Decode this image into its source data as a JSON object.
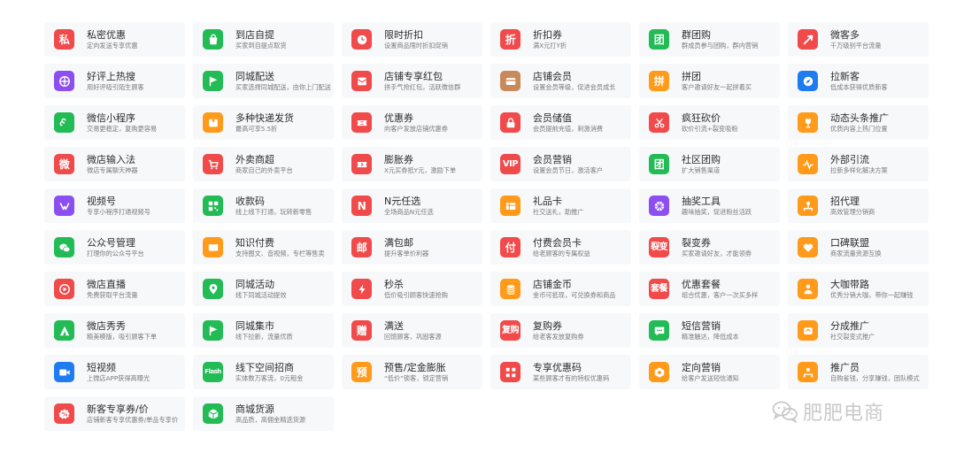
{
  "cards": [
    {
      "title": "私密优惠",
      "desc": "定向发送专享优惠",
      "icon": "private-icon",
      "glyph": "私",
      "color": "#f04a4a"
    },
    {
      "title": "到店自提",
      "desc": "买家到自提点取货",
      "icon": "bag-icon",
      "color": "#22bb55"
    },
    {
      "title": "限时折扣",
      "desc": "设置商品限时折扣促销",
      "icon": "clock-icon",
      "color": "#f04a4a"
    },
    {
      "title": "折扣券",
      "desc": "满X元打Y折",
      "icon": "discount-coupon-icon",
      "glyph": "折",
      "color": "#f04a4a"
    },
    {
      "title": "群团购",
      "desc": "群成员参与团购，群内营销",
      "icon": "group-buy-icon",
      "glyph": "团",
      "color": "#22bb55"
    },
    {
      "title": "微客多",
      "desc": "千万级别平台流量",
      "icon": "rocket-icon",
      "color": "#f04a4a"
    },
    {
      "title": "好评上热搜",
      "desc": "用好评吸引陌生顾客",
      "icon": "hot-search-icon",
      "color": "#8b4ef0"
    },
    {
      "title": "同城配送",
      "desc": "买家选择同城配送，由你上门配送服务",
      "icon": "flag-icon",
      "color": "#22bb55"
    },
    {
      "title": "店铺专享红包",
      "desc": "拼手气抢红包，活跃微信群",
      "icon": "red-packet-icon",
      "color": "#f04a4a"
    },
    {
      "title": "店铺会员",
      "desc": "设置会员等级，促进会员成长",
      "icon": "member-card-icon",
      "color": "#c9895a"
    },
    {
      "title": "拼团",
      "desc": "客户邀请好友一起拼着买",
      "icon": "pintuan-icon",
      "glyph": "拼",
      "color": "#ff9a1a"
    },
    {
      "title": "拉新客",
      "desc": "低成本获得优质新客",
      "icon": "compass-icon",
      "color": "#1f7cf0"
    },
    {
      "title": "微信小程序",
      "desc": "交易更稳定，复购更容易",
      "icon": "mini-program-icon",
      "color": "#22bb55"
    },
    {
      "title": "多种快递发货",
      "desc": "最高可享5.5折",
      "icon": "package-icon",
      "color": "#ff9a1a"
    },
    {
      "title": "优惠券",
      "desc": "向客户发放店铺优惠券",
      "icon": "ticket-icon",
      "color": "#f04a4a"
    },
    {
      "title": "会员储值",
      "desc": "会员提前充值，刺激消费",
      "icon": "lock-icon",
      "color": "#f04a4a"
    },
    {
      "title": "疯狂砍价",
      "desc": "砍价引流+裂变吸粉",
      "icon": "scissors-icon",
      "color": "#f04a4a"
    },
    {
      "title": "动态头条推广",
      "desc": "优质内容上热门位置",
      "icon": "trophy-icon",
      "color": "#ff9a1a"
    },
    {
      "title": "微店输入法",
      "desc": "微店专属聊天神器",
      "icon": "keyboard-icon",
      "glyph": "微",
      "color": "#f04a4a"
    },
    {
      "title": "外卖商超",
      "desc": "商家自己的外卖平台",
      "icon": "cart-icon",
      "color": "#f04a4a"
    },
    {
      "title": "膨胀券",
      "desc": "X元买券抵Y元，激励下单",
      "icon": "expand-coupon-icon",
      "color": "#f04a4a"
    },
    {
      "title": "会员营销",
      "desc": "设置会员节日，激活客户",
      "icon": "vip-icon",
      "glyph": "VIP",
      "color": "#f04a4a"
    },
    {
      "title": "社区团购",
      "desc": "扩大销售渠道",
      "icon": "community-icon",
      "glyph": "团",
      "color": "#22bb55"
    },
    {
      "title": "外部引流",
      "desc": "拉新多样化解决方案",
      "icon": "pulse-icon",
      "color": "#ff9a1a"
    },
    {
      "title": "视频号",
      "desc": "专享小程序打通视频号",
      "icon": "channels-icon",
      "color": "#8b4ef0"
    },
    {
      "title": "收款码",
      "desc": "线上线下打通，玩转新零售",
      "icon": "qr-icon",
      "color": "#22bb55"
    },
    {
      "title": "N元任选",
      "desc": "全场商品N元任选",
      "icon": "n-yuan-icon",
      "glyph": "N",
      "color": "#f04a4a"
    },
    {
      "title": "礼品卡",
      "desc": "社交送礼，助推广",
      "icon": "gift-card-icon",
      "color": "#ff9a1a"
    },
    {
      "title": "抽奖工具",
      "desc": "趣味抽奖，促进粉丝活跃",
      "icon": "lottery-icon",
      "color": "#8b4ef0"
    },
    {
      "title": "招代理",
      "desc": "高效管理分销商",
      "icon": "agent-icon",
      "color": "#ff9a1a"
    },
    {
      "title": "公众号管理",
      "desc": "打理你的公众号平台",
      "icon": "wechat-icon",
      "color": "#22bb55"
    },
    {
      "title": "知识付费",
      "desc": "支持图文、音视频，专栏等售卖",
      "icon": "book-icon",
      "color": "#ff9a1a"
    },
    {
      "title": "满包邮",
      "desc": "提升客单价利器",
      "icon": "free-shipping-icon",
      "glyph": "邮",
      "color": "#f04a4a"
    },
    {
      "title": "付费会员卡",
      "desc": "给老顾客的专属权益",
      "icon": "paid-card-icon",
      "glyph": "付",
      "color": "#f04a4a"
    },
    {
      "title": "裂变券",
      "desc": "买家邀请好友，才能领券",
      "icon": "fission-icon",
      "glyph": "裂变",
      "color": "#f04a4a"
    },
    {
      "title": "口碑联盟",
      "desc": "商家流量资源互换",
      "icon": "heart-icon",
      "color": "#ff9a1a"
    },
    {
      "title": "微店直播",
      "desc": "免费获取平台流量",
      "icon": "live-icon",
      "color": "#f04a4a"
    },
    {
      "title": "同城活动",
      "desc": "线下同城活动提效",
      "icon": "location-icon",
      "color": "#22bb55"
    },
    {
      "title": "秒杀",
      "desc": "低价吸引顾客快速抢购",
      "icon": "flash-icon",
      "color": "#f04a4a"
    },
    {
      "title": "店铺金币",
      "desc": "金币可抵现，可兑换券和商品",
      "icon": "coins-icon",
      "color": "#ff9a1a"
    },
    {
      "title": "优惠套餐",
      "desc": "组合优惠，客户一次买多样",
      "icon": "bundle-icon",
      "glyph": "套餐",
      "color": "#f04a4a"
    },
    {
      "title": "大咖带路",
      "desc": "优秀分销大咖，带你一起赚钱",
      "icon": "mentor-icon",
      "color": "#ff9a1a"
    },
    {
      "title": "微店秀秀",
      "desc": "精美模版，吸引顾客下单",
      "icon": "tent-icon",
      "color": "#22bb55"
    },
    {
      "title": "同城集市",
      "desc": "线下拉新，流量优质",
      "icon": "market-flag-icon",
      "color": "#22bb55"
    },
    {
      "title": "满送",
      "desc": "回馈顾客，巩固客源",
      "icon": "gift-send-icon",
      "glyph": "赠",
      "color": "#f04a4a"
    },
    {
      "title": "复购券",
      "desc": "给老客发放复购券",
      "icon": "repurchase-icon",
      "glyph": "复购",
      "color": "#f04a4a"
    },
    {
      "title": "短信营销",
      "desc": "精准触达，降低成本",
      "icon": "sms-icon",
      "color": "#22bb55"
    },
    {
      "title": "分成推广",
      "desc": "社交裂变式推广",
      "icon": "share-icon",
      "color": "#ff9a1a"
    },
    {
      "title": "短视频",
      "desc": "上微店APP获得高曝光",
      "icon": "video-icon",
      "color": "#1f7cf0"
    },
    {
      "title": "线下空间招商",
      "desc": "实体数万客流，0元租金",
      "icon": "space-icon",
      "glyph": "Flash",
      "color": "#22bb55"
    },
    {
      "title": "预售/定金膨胀",
      "desc": "“低价”锁客，锁定营销",
      "icon": "presale-icon",
      "glyph": "预",
      "color": "#ff9a1a"
    },
    {
      "title": "专享优惠码",
      "desc": "某些顾客才有的特权优惠码",
      "icon": "code-icon",
      "color": "#f04a4a"
    },
    {
      "title": "定向营销",
      "desc": "给客户发送短信通知",
      "icon": "target-icon",
      "color": "#ff9a1a"
    },
    {
      "title": "推广员",
      "desc": "自购省钱，分享赚钱，团队模式",
      "icon": "promoter-icon",
      "color": "#ff9a1a"
    },
    {
      "title": "新客专享券/价",
      "desc": "店铺新客专享优惠券/单品专享价",
      "icon": "new-customer-icon",
      "color": "#f04a4a"
    },
    {
      "title": "商城货源",
      "desc": "高品质，高佣金精选货源",
      "icon": "cube-icon",
      "color": "#22bb55"
    }
  ],
  "watermark": {
    "text": "肥肥电商",
    "icon": "wechat-logo-icon"
  }
}
